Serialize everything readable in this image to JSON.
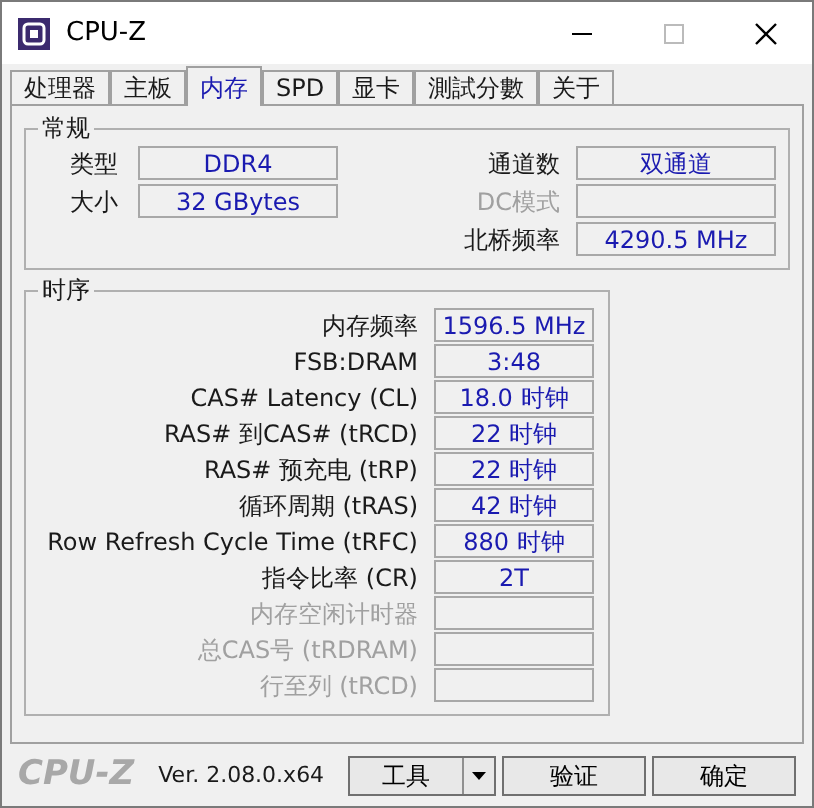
{
  "window": {
    "title": "CPU-Z"
  },
  "tabs": [
    {
      "label": "处理器",
      "selected": false
    },
    {
      "label": "主板",
      "selected": false
    },
    {
      "label": "内存",
      "selected": true
    },
    {
      "label": "SPD",
      "selected": false
    },
    {
      "label": "显卡",
      "selected": false
    },
    {
      "label": "測試分數",
      "selected": false
    },
    {
      "label": "关于",
      "selected": false
    }
  ],
  "general": {
    "title": "常规",
    "left": [
      {
        "label": "类型",
        "value": "DDR4",
        "disabled": false
      },
      {
        "label": "大小",
        "value": "32 GBytes",
        "disabled": false
      }
    ],
    "right": [
      {
        "label": "通道数",
        "value": "双通道",
        "disabled": false
      },
      {
        "label": "DC模式",
        "disabled": true
      },
      {
        "label": "北桥频率",
        "value": "4290.5 MHz",
        "disabled": false
      }
    ]
  },
  "timings": {
    "title": "时序",
    "rows": [
      {
        "label": "内存频率",
        "value": "1596.5 MHz",
        "disabled": false
      },
      {
        "label": "FSB:DRAM",
        "value": "3:48",
        "disabled": false
      },
      {
        "label": "CAS# Latency (CL)",
        "value": "18.0 时钟",
        "disabled": false
      },
      {
        "label": "RAS# 到CAS# (tRCD)",
        "value": "22 时钟",
        "disabled": false
      },
      {
        "label": "RAS# 预充电 (tRP)",
        "value": "22 时钟",
        "disabled": false
      },
      {
        "label": "循环周期 (tRAS)",
        "value": "42 时钟",
        "disabled": false
      },
      {
        "label": "Row Refresh Cycle Time (tRFC)",
        "value": "880 时钟",
        "disabled": false
      },
      {
        "label": "指令比率 (CR)",
        "value": "2T",
        "disabled": false
      },
      {
        "label": "内存空闲计时器",
        "disabled": true
      },
      {
        "label": "总CAS号 (tRDRAM)",
        "disabled": true
      },
      {
        "label": "行至列 (tRCD)",
        "disabled": true
      }
    ]
  },
  "footer": {
    "logo": "CPU-Z",
    "version": "Ver. 2.08.0.x64",
    "buttons": [
      {
        "label": "工具",
        "kind": "dropdown"
      },
      {
        "label": "验证",
        "kind": "plain"
      },
      {
        "label": "确定",
        "kind": "plain"
      }
    ]
  }
}
